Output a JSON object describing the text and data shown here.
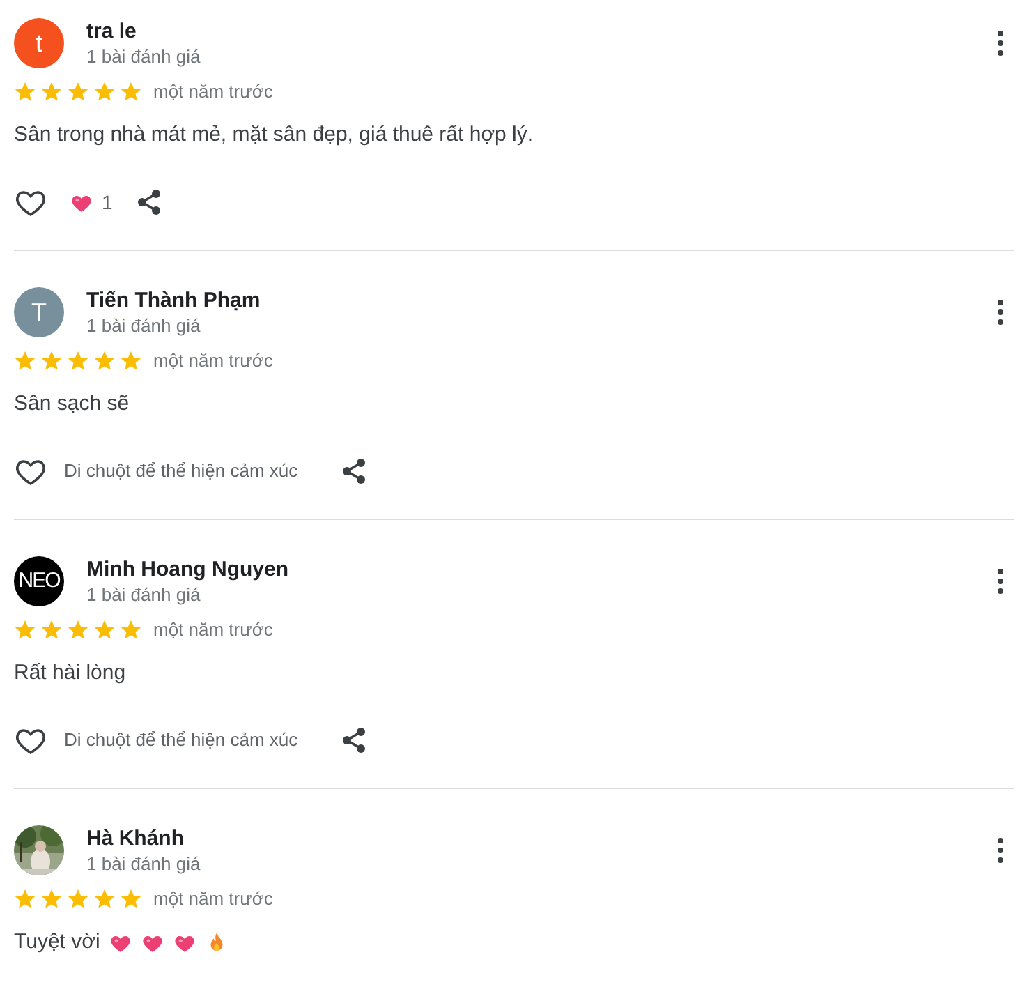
{
  "reviews": [
    {
      "author": "tra le",
      "avatar": {
        "kind": "letter",
        "letter": "t",
        "color": "#f4511e"
      },
      "review_count": "1 bài đánh giá",
      "stars": 5,
      "time": "một năm trước",
      "text": "Sân trong nhà mát mẻ, mặt sân đẹp, giá thuê rất hợp lý.",
      "liked": false,
      "reaction_count": "1"
    },
    {
      "author": "Tiến Thành Phạm",
      "avatar": {
        "kind": "letter",
        "letter": "T",
        "color": "#78909c"
      },
      "review_count": "1 bài đánh giá",
      "stars": 5,
      "time": "một năm trước",
      "text": "Sân sạch sẽ",
      "liked": false,
      "reaction_hint": "Di chuột để thể hiện cảm xúc"
    },
    {
      "author": "Minh Hoang Nguyen",
      "avatar": {
        "kind": "logo",
        "letter": "NEO",
        "color": "#000000"
      },
      "review_count": "1 bài đánh giá",
      "stars": 5,
      "time": "một năm trước",
      "text": "Rất hài lòng",
      "liked": false,
      "reaction_hint": "Di chuột để thể hiện cảm xúc"
    },
    {
      "author": "Hà Khánh",
      "review_count": "1 bài đánh giá",
      "stars": 5,
      "time": "một năm trước",
      "text": "Tuyệt vời",
      "emojis": [
        {
          "kind": "heart"
        },
        {
          "kind": "heart"
        },
        {
          "kind": "heart"
        },
        {
          "kind": "fire"
        }
      ]
    }
  ]
}
